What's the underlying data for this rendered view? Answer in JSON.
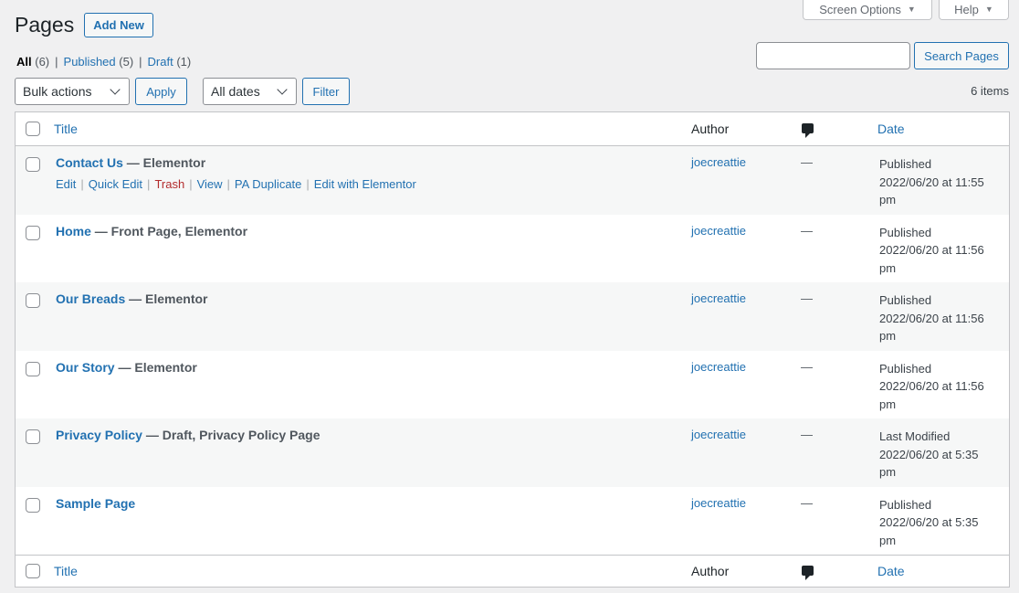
{
  "screen_meta": {
    "screen_options": "Screen Options",
    "help": "Help"
  },
  "heading": {
    "title": "Pages",
    "add_new": "Add New"
  },
  "views": {
    "all": "All",
    "all_count": "(6)",
    "published": "Published",
    "published_count": "(5)",
    "draft": "Draft",
    "draft_count": "(1)",
    "separator": "|"
  },
  "search": {
    "value": "",
    "button": "Search Pages"
  },
  "tablenav": {
    "bulk_actions": "Bulk actions",
    "apply": "Apply",
    "dates": "All dates",
    "filter": "Filter",
    "items_count": "6 items"
  },
  "columns": {
    "title": "Title",
    "author": "Author",
    "date": "Date"
  },
  "row_actions": {
    "edit": "Edit",
    "quick_edit": "Quick Edit",
    "trash": "Trash",
    "view": "View",
    "duplicate": "PA Duplicate",
    "edit_elementor": "Edit with Elementor"
  },
  "rows": [
    {
      "title": "Contact Us",
      "state": " — Elementor",
      "author": "joecreattie",
      "comments": "—",
      "status": "Published",
      "date": "2022/06/20 at 11:55",
      "time_suffix": "pm"
    },
    {
      "title": "Home",
      "state": " — Front Page, Elementor",
      "author": "joecreattie",
      "comments": "—",
      "status": "Published",
      "date": "2022/06/20 at 11:56",
      "time_suffix": "pm"
    },
    {
      "title": "Our Breads",
      "state": " — Elementor",
      "author": "joecreattie",
      "comments": "—",
      "status": "Published",
      "date": "2022/06/20 at 11:56",
      "time_suffix": "pm"
    },
    {
      "title": "Our Story",
      "state": " — Elementor",
      "author": "joecreattie",
      "comments": "—",
      "status": "Published",
      "date": "2022/06/20 at 11:56",
      "time_suffix": "pm"
    },
    {
      "title": "Privacy Policy",
      "state": " — Draft, Privacy Policy Page",
      "author": "joecreattie",
      "comments": "—",
      "status": "Last Modified",
      "date": "2022/06/20 at 5:35",
      "time_suffix": "pm"
    },
    {
      "title": "Sample Page",
      "state": "",
      "author": "joecreattie",
      "comments": "—",
      "status": "Published",
      "date": "2022/06/20 at 5:35",
      "time_suffix": "pm"
    }
  ]
}
